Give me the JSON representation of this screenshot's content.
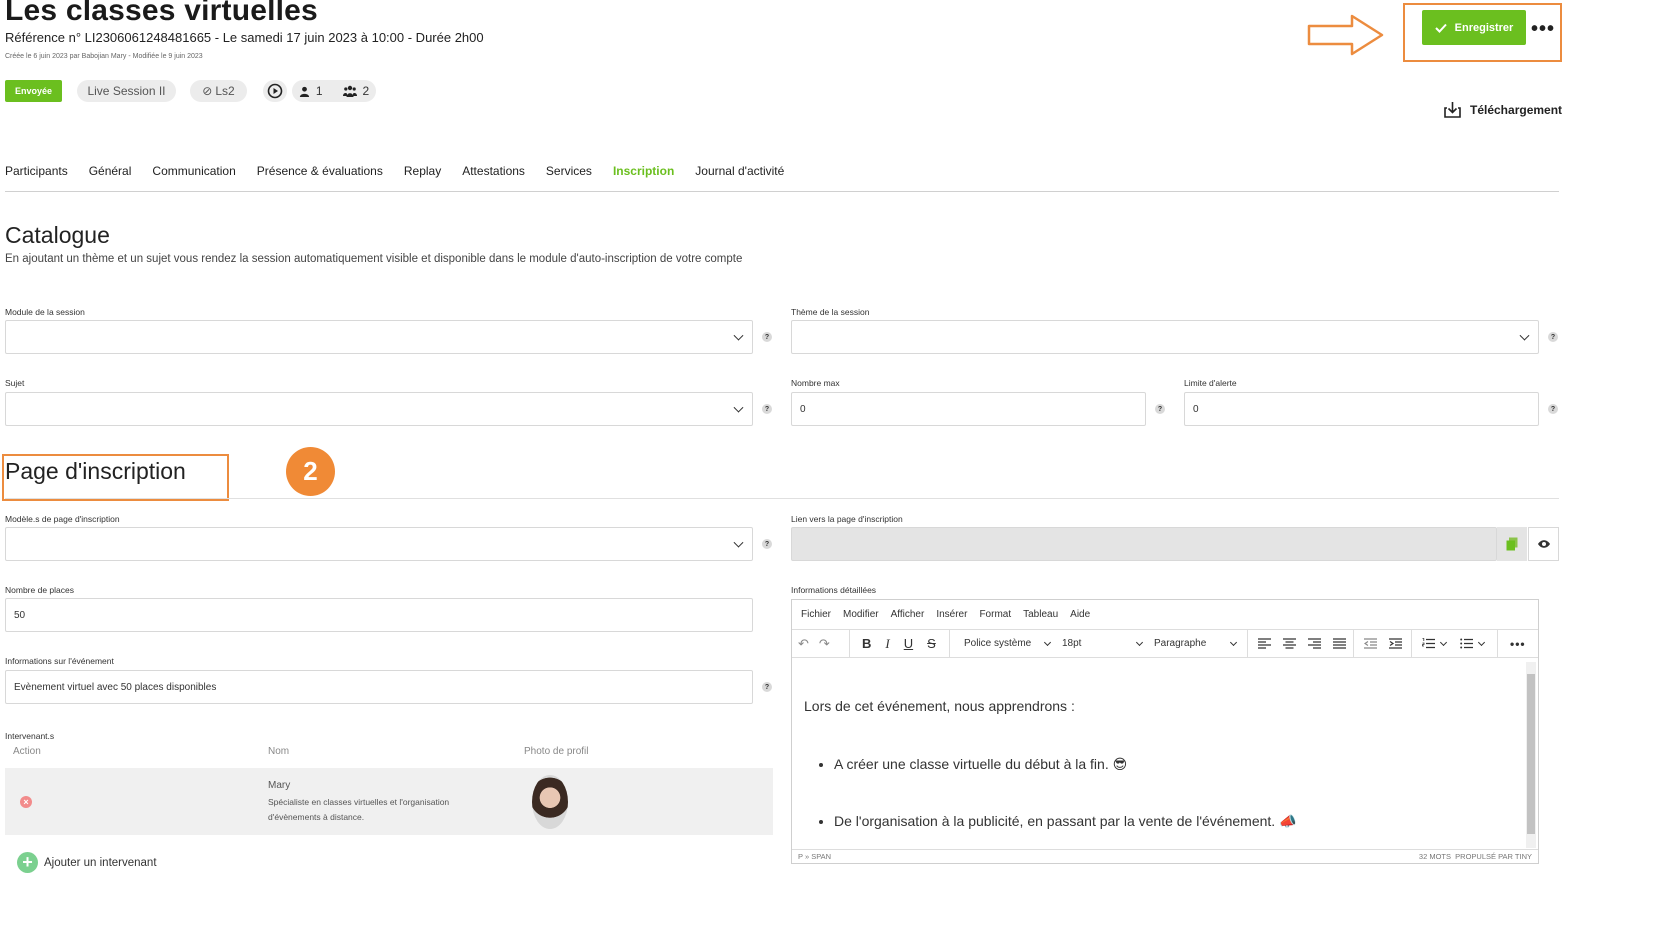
{
  "header": {
    "title": "Les classes virtuelles",
    "subtitle": "Référence n° LI2306061248481665 - Le samedi 17 juin 2023 à 10:00 - Durée 2h00",
    "meta": "Créée le 6 juin 2023 par Babojian Mary - Modifiée le 9 juin 2023",
    "status_badge": "Envoyée",
    "session_type": "Live Session II",
    "room": "Ls2",
    "participants_count": "1",
    "groups_count": "2",
    "save_label": "Enregistrer",
    "more_label": "•••",
    "download_label": "Téléchargement"
  },
  "tabs": [
    {
      "label": "Participants"
    },
    {
      "label": "Général"
    },
    {
      "label": "Communication"
    },
    {
      "label": "Présence & évaluations"
    },
    {
      "label": "Replay"
    },
    {
      "label": "Attestations"
    },
    {
      "label": "Services"
    },
    {
      "label": "Inscription",
      "active": true
    },
    {
      "label": "Journal d'activité"
    }
  ],
  "catalogue": {
    "title": "Catalogue",
    "description": "En ajoutant un thème et un sujet vous rendez la session automatiquement visible et disponible dans le module d'auto-inscription de votre compte",
    "module_label": "Module de la session",
    "theme_label": "Thème de la session",
    "subject_label": "Sujet",
    "max_label": "Nombre max",
    "max_value": "0",
    "alert_label": "Limite d'alerte",
    "alert_value": "0"
  },
  "registration": {
    "title": "Page d'inscription",
    "step_number": "2",
    "templates_label": "Modèle.s de page d'inscription",
    "link_label": "Lien vers la page d'inscription",
    "seats_label": "Nombre de places",
    "seats_value": "50",
    "event_info_label": "Informations sur l'événement",
    "event_info_value": "Evènement virtuel avec 50 places disponibles",
    "speakers_label": "Intervenant.s",
    "col_action": "Action",
    "col_name": "Nom",
    "col_photo": "Photo de profil",
    "speaker_name": "Mary",
    "speaker_bio_1": "Spécialiste en classes virtuelles et l'organisation",
    "speaker_bio_2": "d'évènements à distance.",
    "add_speaker": "Ajouter un intervenant",
    "details_label": "Informations détaillées"
  },
  "editor": {
    "menu": [
      "Fichier",
      "Modifier",
      "Afficher",
      "Insérer",
      "Format",
      "Tableau",
      "Aide"
    ],
    "font_family": "Police système",
    "font_size": "18pt",
    "block_format": "Paragraphe",
    "paragraph": "Lors de cet événement, nous apprendrons :",
    "bullet_1": "A créer une classe virtuelle du début à la fin.",
    "bullet_2": "De l'organisation à la publicité, en passant par la vente de l'événement.",
    "path": "P » SPAN",
    "word_count": "32 MOTS",
    "powered_by": "PROPULSÉ PAR TINY"
  }
}
